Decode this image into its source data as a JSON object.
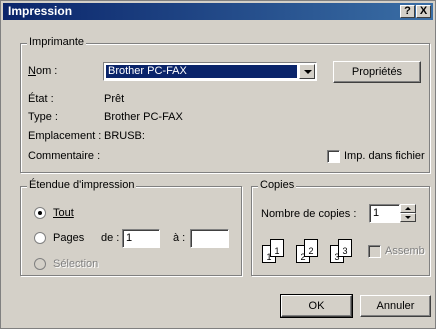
{
  "title": "Impression",
  "titlebar": {
    "help": "?",
    "close": "X"
  },
  "printer": {
    "legend": "Imprimante",
    "name_label": "Nom :",
    "name_value": "Brother PC-FAX",
    "properties_button": "Propriétés",
    "state_label": "État :",
    "state_value": "Prêt",
    "type_label": "Type :",
    "type_value": "Brother PC-FAX",
    "location_label": "Emplacement :",
    "location_value": "BRUSB:",
    "comment_label": "Commentaire :",
    "print_to_file": "Imp. dans fichier"
  },
  "range": {
    "legend": "Étendue d'impression",
    "all": "Tout",
    "pages": "Pages",
    "from": "de :",
    "from_value": "1",
    "to": "à :",
    "to_value": "",
    "selection": "Sélection"
  },
  "copies": {
    "legend": "Copies",
    "count_label": "Nombre de copies :",
    "count_value": "1",
    "collate": "Assemb",
    "pages": [
      "1",
      "1",
      "2",
      "2",
      "3",
      "3"
    ]
  },
  "buttons": {
    "ok": "OK",
    "cancel": "Annuler"
  }
}
